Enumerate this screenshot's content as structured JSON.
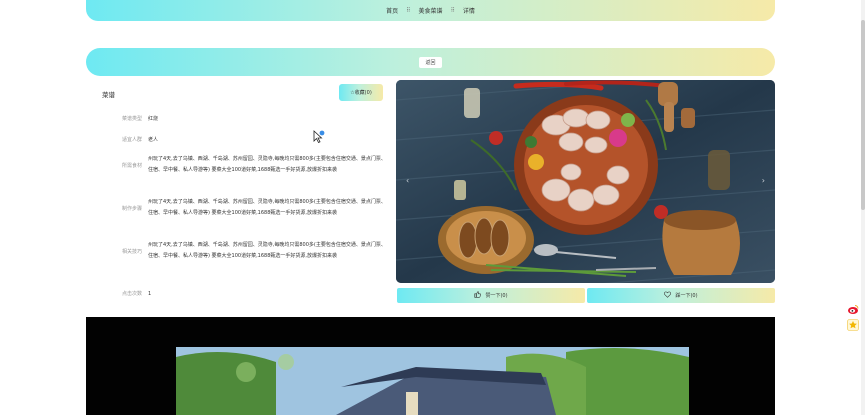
{
  "breadcrumb": {
    "home": "首页",
    "sep": "⠿",
    "category": "美食菜谱",
    "detail": "详情"
  },
  "banner": {
    "back_label": "返回"
  },
  "recipe": {
    "title": "菜谱",
    "collect_label": "☆收藏(0)",
    "fields": [
      {
        "label": "菜谱类型",
        "value": "红烧"
      },
      {
        "label": "适宜人群",
        "value": "老人"
      },
      {
        "label": "所需食材",
        "value": "州玩了4天,去了乌镇、西湖、千岛湖、苏州留园、灵隐寺,每晚均只需800多(主要包含住宿交通、景点门票、住宿、早中餐、私人导游等) 要菜大全100道好菜,1688甄选一手好货源,放爆折扣来袭"
      },
      {
        "label": "制作步骤",
        "value": "州玩了4天,去了乌镇、西湖、千岛湖、苏州留园、灵隐寺,每晚均只需800多(主要包含住宿交通、景点门票、住宿、早中餐、私人导游等) 要菜大全100道好菜,1688甄选一手好货源,放爆折扣来袭"
      },
      {
        "label": "相关技巧",
        "value": "州玩了4天,去了乌镇、西湖、千岛湖、苏州留园、灵隐寺,每晚均只需800多(主要包含住宿交通、景点门票、住宿、早中餐、私人导游等) 要菜大全100道好菜,1688甄选一手好货源,放爆折扣来袭"
      },
      {
        "label": "点击次数",
        "value": "1"
      }
    ]
  },
  "actions": {
    "like_label": "赞一下(0)",
    "dislike_label": "踩一下(0)"
  },
  "carousel": {
    "prev": "‹",
    "next": "›"
  },
  "colors": {
    "gradient_start": "#6ee9f2",
    "gradient_end": "#f6eaa8"
  }
}
